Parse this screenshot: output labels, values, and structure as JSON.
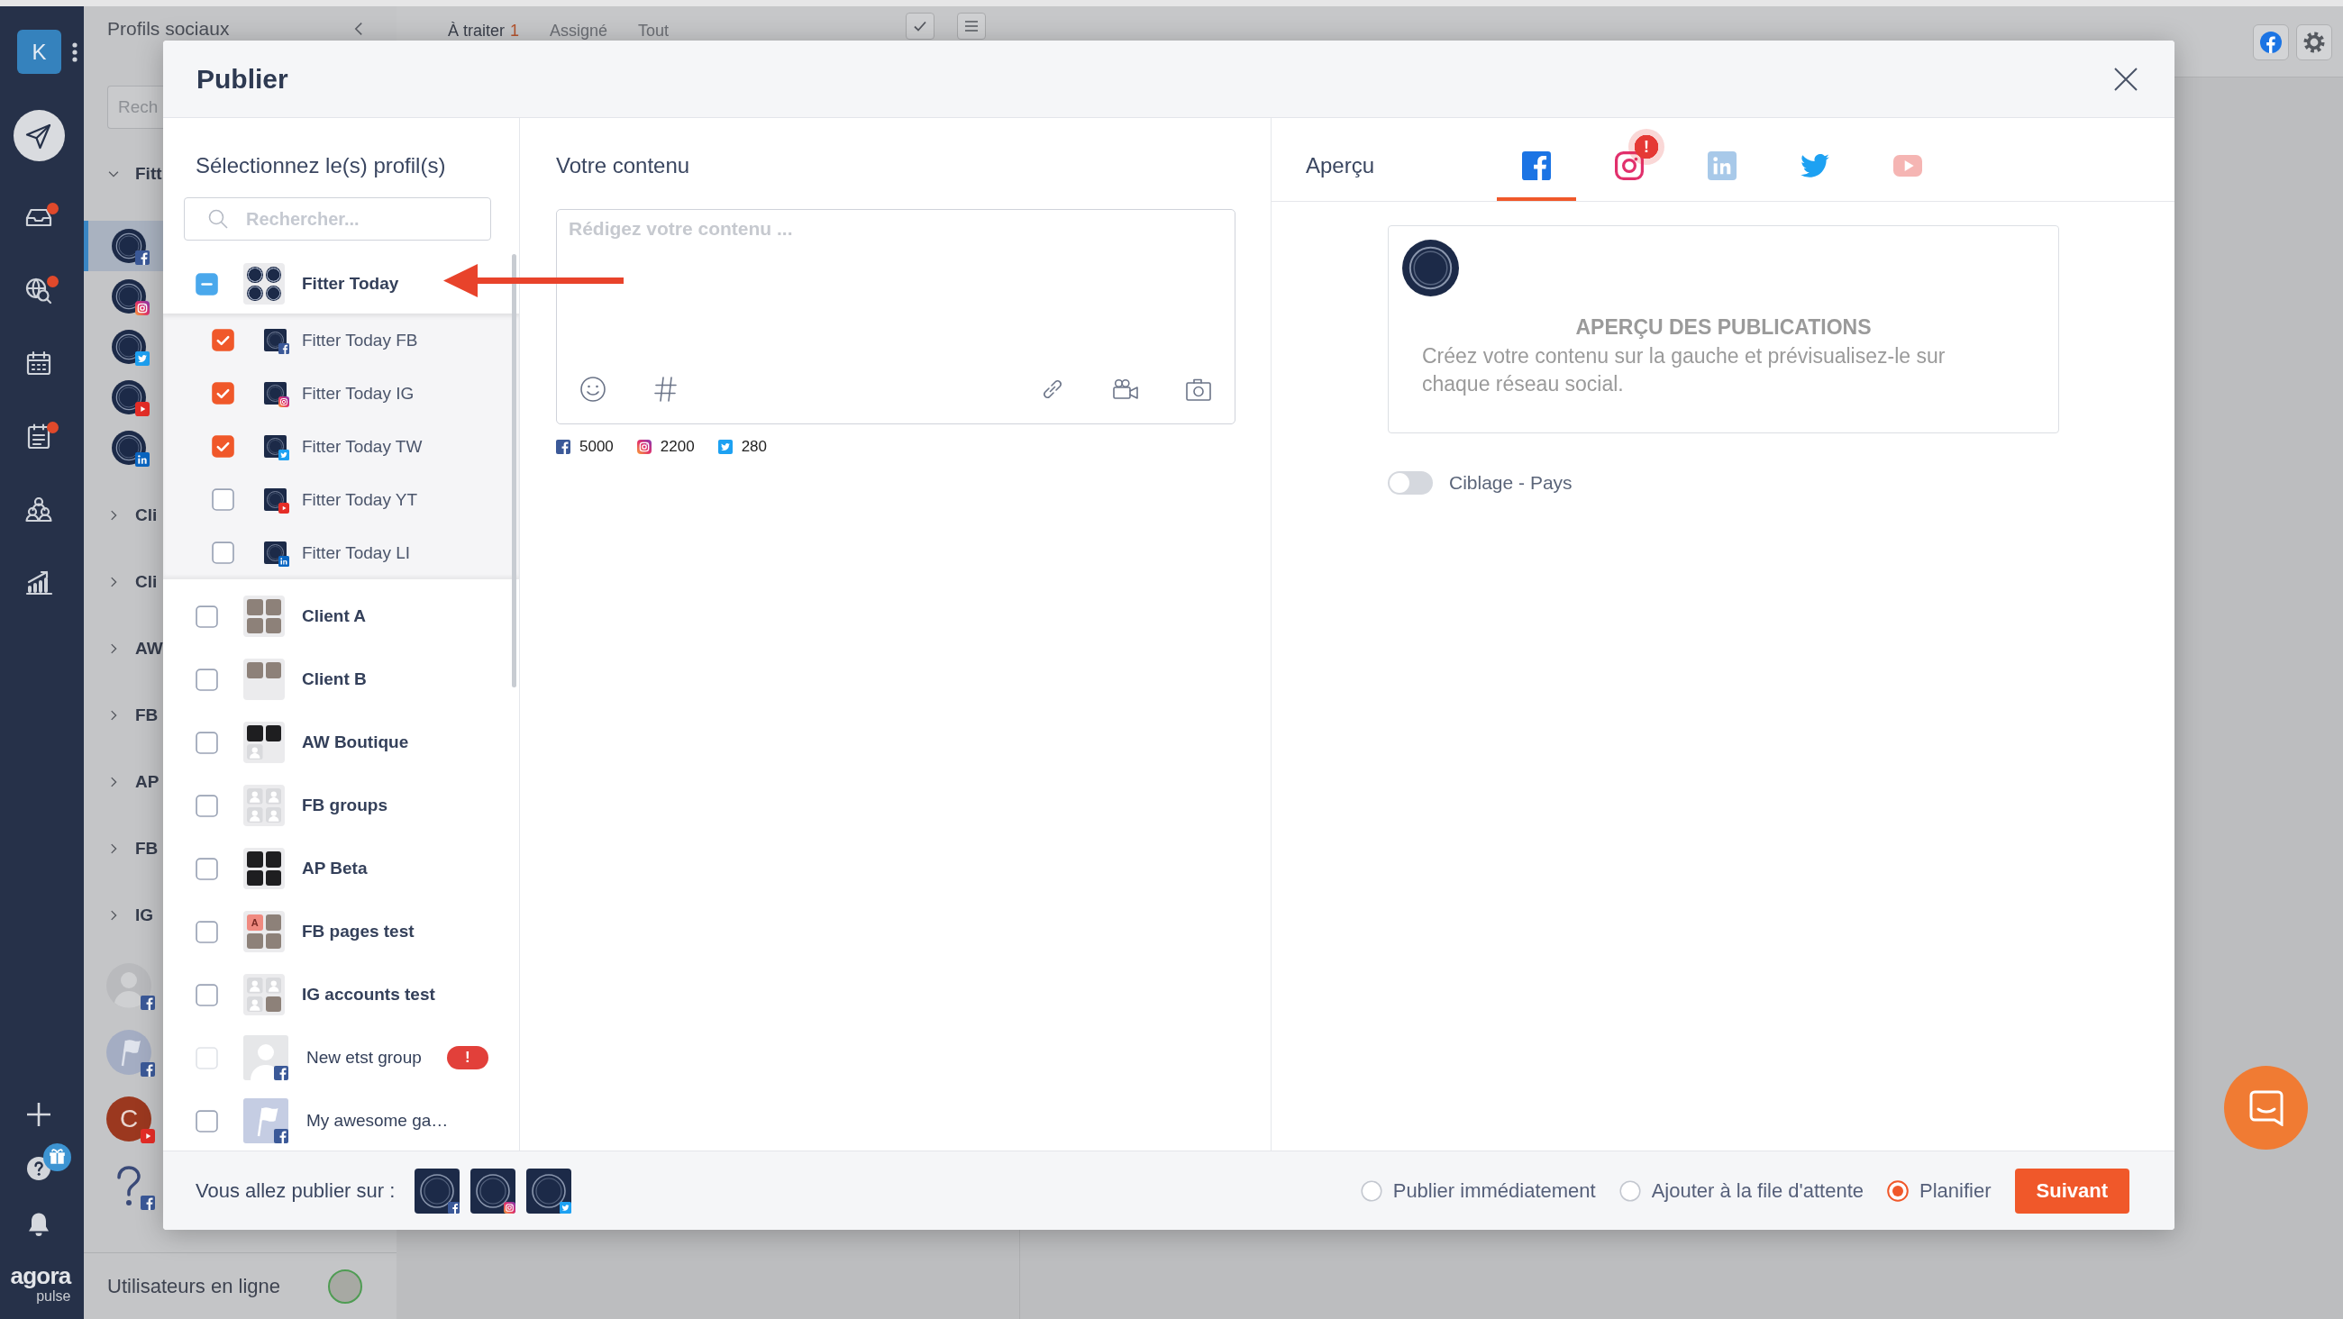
{
  "nav": {
    "account": "K",
    "items": [
      {
        "kind": "publish",
        "selected": true,
        "alert": false
      },
      {
        "kind": "inbox",
        "selected": false,
        "alert": true
      },
      {
        "kind": "listening",
        "selected": false,
        "alert": true
      },
      {
        "kind": "calendar",
        "selected": false,
        "alert": false
      },
      {
        "kind": "reports",
        "selected": false,
        "alert": true
      },
      {
        "kind": "team",
        "selected": false,
        "alert": false
      },
      {
        "kind": "statistics",
        "selected": false,
        "alert": false
      }
    ],
    "bottom": [
      {
        "kind": "add"
      },
      {
        "kind": "help"
      },
      {
        "kind": "notifications"
      }
    ],
    "logo": {
      "name": "agora",
      "tagline": "pulse"
    }
  },
  "profiles_panel": {
    "title": "Profils sociaux",
    "search": {
      "placeholder": "Rech"
    },
    "groups": [
      {
        "label": "Fitt",
        "expanded": true,
        "children": [
          {
            "kind": "facebook",
            "selected": true
          },
          {
            "kind": "instagram",
            "selected": false
          },
          {
            "kind": "twitter",
            "selected": false
          },
          {
            "kind": "youtube",
            "selected": false
          },
          {
            "kind": "linkedin",
            "selected": false
          }
        ]
      },
      {
        "label": "Cli",
        "expanded": false
      },
      {
        "label": "Cli",
        "expanded": false
      },
      {
        "label": "AW",
        "expanded": false
      },
      {
        "label": "FB",
        "expanded": false
      },
      {
        "label": "AP",
        "expanded": false
      },
      {
        "label": "FB",
        "expanded": false
      },
      {
        "label": "IG",
        "expanded": false
      }
    ],
    "accounts": [
      {
        "kind": "person",
        "badge": {
          "kind": "facebook"
        }
      },
      {
        "kind": "flag",
        "badge": {
          "kind": "facebook"
        }
      },
      {
        "kind": "initial",
        "initial": "C",
        "badge": {
          "kind": "youtube"
        }
      },
      {
        "kind": "question",
        "badge": {
          "kind": "facebook"
        }
      }
    ],
    "online_users": {
      "label": "Utilisateurs en ligne"
    }
  },
  "main_header": {
    "tabs": [
      {
        "label": "À traiter",
        "count": "1",
        "selected": true
      },
      {
        "label": "Assigné",
        "selected": false
      },
      {
        "label": "Tout",
        "selected": false
      }
    ],
    "tools": [
      {
        "kind": "check"
      },
      {
        "kind": "list"
      }
    ],
    "actions": [
      {
        "kind": "facebook"
      },
      {
        "kind": "settings"
      }
    ]
  },
  "modal": {
    "title": "Publier",
    "profiles": {
      "heading": "Sélectionnez le(s) profil(s)",
      "search": {
        "placeholder": "Rechercher..."
      },
      "groups": [
        {
          "kind": "group",
          "name": "Fitter Today",
          "checked": false,
          "partial": true,
          "disabled": false,
          "tiles": [
            {
              "kind": "logo"
            },
            {
              "kind": "logo"
            },
            {
              "kind": "logo"
            },
            {
              "kind": "logo"
            }
          ],
          "children": [
            {
              "name": "Fitter Today FB",
              "kind": "facebook",
              "checked": true
            },
            {
              "name": "Fitter Today IG",
              "kind": "instagram",
              "checked": true
            },
            {
              "name": "Fitter Today TW",
              "kind": "twitter",
              "checked": true
            },
            {
              "name": "Fitter Today YT",
              "kind": "youtube",
              "checked": false
            },
            {
              "name": "Fitter Today LI",
              "kind": "linkedin",
              "checked": false
            }
          ]
        },
        {
          "kind": "group",
          "name": "Client A",
          "checked": false,
          "partial": false,
          "disabled": false,
          "tiles": [
            {
              "kind": "photo"
            },
            {
              "kind": "photo"
            },
            {
              "kind": "photo"
            },
            {
              "kind": "photo"
            }
          ]
        },
        {
          "kind": "group",
          "name": "Client B",
          "checked": false,
          "partial": false,
          "disabled": false,
          "tiles": [
            {
              "kind": "photo"
            },
            {
              "kind": "photo"
            },
            {
              "kind": "empty"
            },
            {
              "kind": "empty"
            }
          ]
        },
        {
          "kind": "group",
          "name": "AW Boutique",
          "checked": false,
          "partial": false,
          "disabled": false,
          "tiles": [
            {
              "kind": "dark"
            },
            {
              "kind": "dark"
            },
            {
              "kind": "person"
            },
            {
              "kind": "empty"
            }
          ]
        },
        {
          "kind": "group",
          "name": "FB groups",
          "checked": false,
          "partial": false,
          "disabled": false,
          "tiles": [
            {
              "kind": "person"
            },
            {
              "kind": "person"
            },
            {
              "kind": "person"
            },
            {
              "kind": "person"
            }
          ]
        },
        {
          "kind": "group",
          "name": "AP Beta",
          "checked": false,
          "partial": false,
          "disabled": false,
          "tiles": [
            {
              "kind": "dark"
            },
            {
              "kind": "dark"
            },
            {
              "kind": "dark"
            },
            {
              "kind": "dark"
            }
          ]
        },
        {
          "kind": "group",
          "name": "FB pages test",
          "checked": false,
          "partial": false,
          "disabled": false,
          "tiles": [
            {
              "kind": "letter",
              "text": "A"
            },
            {
              "kind": "photo"
            },
            {
              "kind": "photo"
            },
            {
              "kind": "photo"
            }
          ]
        },
        {
          "kind": "group",
          "name": "IG accounts test",
          "checked": false,
          "partial": false,
          "disabled": false,
          "tiles": [
            {
              "kind": "person"
            },
            {
              "kind": "person"
            },
            {
              "kind": "person"
            },
            {
              "kind": "photo"
            }
          ]
        },
        {
          "kind": "profile",
          "name": "New etst group",
          "checked": false,
          "partial": false,
          "disabled": true,
          "photo": {
            "kind": "person"
          },
          "network": {
            "kind": "facebook"
          },
          "alert": "!"
        },
        {
          "kind": "profile",
          "name": "My awesome ga…",
          "checked": false,
          "partial": false,
          "disabled": false,
          "photo": {
            "kind": "flag"
          },
          "network": {
            "kind": "facebook"
          }
        }
      ]
    },
    "composer": {
      "heading": "Votre contenu",
      "placeholder": "Rédigez votre contenu ...",
      "tools": {
        "left": [
          {
            "kind": "emoji"
          },
          {
            "kind": "hashtag"
          }
        ],
        "right": [
          {
            "kind": "link"
          },
          {
            "kind": "video"
          },
          {
            "kind": "photo"
          }
        ]
      },
      "limits": [
        {
          "kind": "facebook",
          "count": "5000"
        },
        {
          "kind": "instagram",
          "count": "2200"
        },
        {
          "kind": "twitter",
          "count": "280"
        }
      ]
    },
    "preview": {
      "heading": "Aperçu",
      "tabs": [
        {
          "kind": "facebook",
          "selected": true,
          "disabled": false
        },
        {
          "kind": "instagram",
          "selected": false,
          "disabled": false,
          "alert": "!"
        },
        {
          "kind": "linkedin",
          "selected": false,
          "disabled": true
        },
        {
          "kind": "twitter",
          "selected": false,
          "disabled": false
        },
        {
          "kind": "youtube",
          "selected": false,
          "disabled": true
        }
      ],
      "card": {
        "title": "APERÇU DES PUBLICATIONS",
        "text": "Créez votre contenu sur la gauche et prévisualisez-le sur chaque réseau social."
      },
      "targeting": {
        "label": "Ciblage - Pays",
        "on": false
      }
    },
    "footer": {
      "label": "Vous allez publier sur :",
      "profiles": [
        {
          "kind": "facebook"
        },
        {
          "kind": "instagram"
        },
        {
          "kind": "twitter"
        }
      ],
      "schedule": [
        {
          "label": "Publier immédiatement",
          "selected": false
        },
        {
          "label": "Ajouter à la file d'attente",
          "selected": false
        },
        {
          "label": "Planifier",
          "selected": true
        }
      ],
      "next": "Suivant"
    }
  },
  "annotation": {
    "kind": "arrow"
  },
  "chat_launcher": {
    "kind": "chat"
  }
}
